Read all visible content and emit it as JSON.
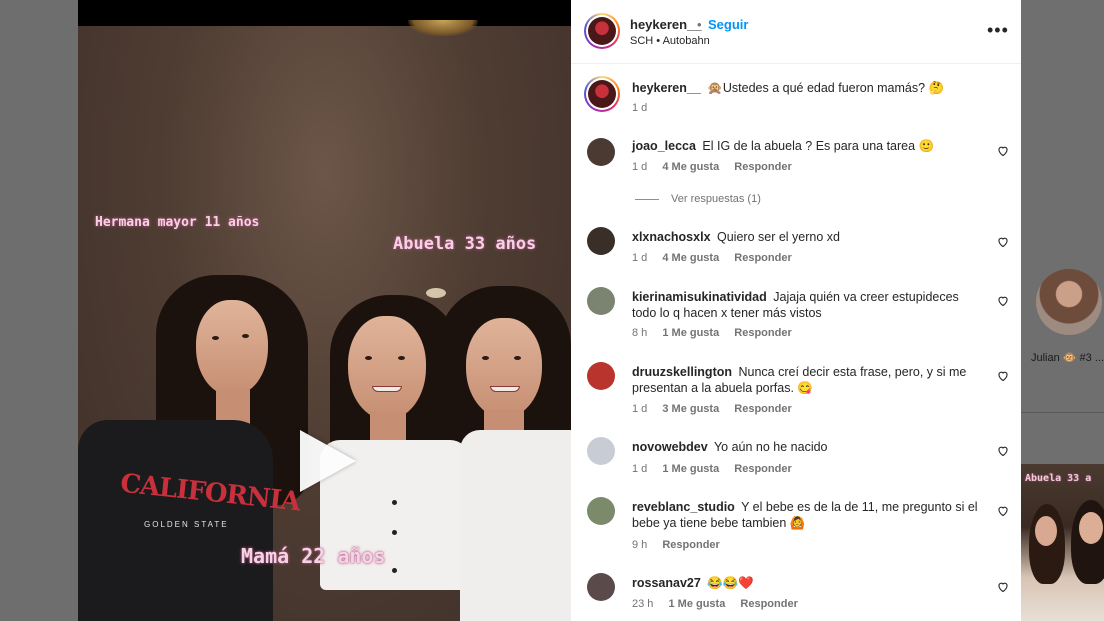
{
  "background_page": {
    "caption": "Julian 🐵 #3 ...",
    "thumb_overlay": "Abuela 33 a"
  },
  "video": {
    "overlay_sister": "Hermana mayor 11 años",
    "overlay_grandma": "Abuela 33 años",
    "overlay_mom": "Mamá 22 años",
    "shirt_print": "CALIFORNIA",
    "shirt_sub": "GOLDEN  STATE"
  },
  "header": {
    "username": "heykeren__",
    "separator": "•",
    "follow_label": "Seguir",
    "location": "SCH • Autobahn",
    "more_icon": "•••"
  },
  "caption": {
    "username": "heykeren__",
    "text": "🙊Ustedes a qué edad fueron mamás? 🤔",
    "time": "1 d"
  },
  "comments": [
    {
      "username": "joao_lecca",
      "text": "El IG de la abuela ? Es para una tarea 🙂",
      "time": "1 d",
      "likes": "4 Me gusta",
      "reply": "Responder",
      "avatar_color": "#4a3a32"
    },
    {
      "username": "xlxnachosxlx",
      "text": "Quiero ser el yerno xd",
      "time": "1 d",
      "likes": "4 Me gusta",
      "reply": "Responder",
      "avatar_color": "#3a2e28"
    },
    {
      "username": "kierinamisukinatividad",
      "text": "Jajaja quién va creer estupideces todo lo q hacen x tener más vistos",
      "time": "8 h",
      "likes": "1 Me gusta",
      "reply": "Responder",
      "avatar_color": "#7a8470"
    },
    {
      "username": "druuzskellington",
      "text": "Nunca creí decir esta frase, pero, y si me presentan a la abuela porfas. 😋",
      "time": "1 d",
      "likes": "3 Me gusta",
      "reply": "Responder",
      "avatar_color": "#b8342c"
    },
    {
      "username": "novowebdev",
      "text": "Yo aún no he nacido",
      "time": "1 d",
      "likes": "1 Me gusta",
      "reply": "Responder",
      "avatar_color": "#c8ccd4"
    },
    {
      "username": "reveblanc_studio",
      "text": "Y el bebe es de la de 11, me pregunto si el bebe ya tiene bebe tambien 🙆",
      "time": "9 h",
      "likes": "",
      "reply": "Responder",
      "avatar_color": "#7a8a6a"
    },
    {
      "username": "rossanav27",
      "text": "😂😂❤️",
      "time": "23 h",
      "likes": "1 Me gusta",
      "reply": "Responder",
      "avatar_color": "#5a4a4a"
    }
  ],
  "view_replies": "Ver respuestas (1)",
  "colors": {
    "follow_blue": "#0095f6",
    "text_primary": "#262626",
    "text_secondary": "#737373",
    "overlay_pink": "#f5d3e6"
  },
  "icons": [
    "play-icon",
    "more-options-icon",
    "heart-icon"
  ]
}
